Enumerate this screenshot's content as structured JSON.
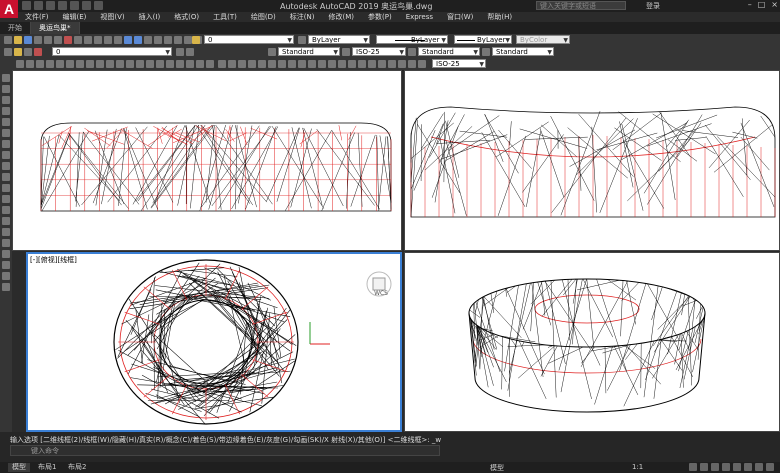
{
  "app": {
    "title": "Autodesk AutoCAD 2019    奥运鸟巢.dwg",
    "search_placeholder": "键入关键字或短语",
    "login_label": "登录"
  },
  "menu": [
    "文件(F)",
    "编辑(E)",
    "视图(V)",
    "插入(I)",
    "格式(O)",
    "工具(T)",
    "绘图(D)",
    "标注(N)",
    "修改(M)",
    "参数(P)",
    "Express",
    "窗口(W)",
    "帮助(H)"
  ],
  "doc_tabs": [
    "开始",
    "奥运鸟巢*"
  ],
  "toolbar": {
    "layer_value": "0",
    "color_value": "ByLayer",
    "linetype_value": "ByLayer",
    "lineweight_value": "ByLayer",
    "plotstyle_value": "ByColor",
    "text_style": "Standard",
    "dim_style": "ISO-25",
    "table_style": "Standard",
    "mleader_style": "Standard",
    "dim_style_2": "ISO-25"
  },
  "viewport3": {
    "label": "[-][俯视][线框]",
    "wcs": "WCS"
  },
  "command": {
    "history": "输入选项 [二维线框(2)/线框(W)/隐藏(H)/真实(R)/概念(C)/着色(S)/带边缘着色(E)/灰度(G)/勾画(SK)/X 射线(X)/其他(O)] <二维线框>: _w",
    "placeholder": "键入命令"
  },
  "status": {
    "tabs": [
      "模型",
      "布局1",
      "布局2"
    ],
    "model_label": "模型",
    "scale": "1:1"
  },
  "colors": {
    "accent": "#3a7fd5",
    "red_lines": "#e02020",
    "black_lines": "#000000"
  }
}
